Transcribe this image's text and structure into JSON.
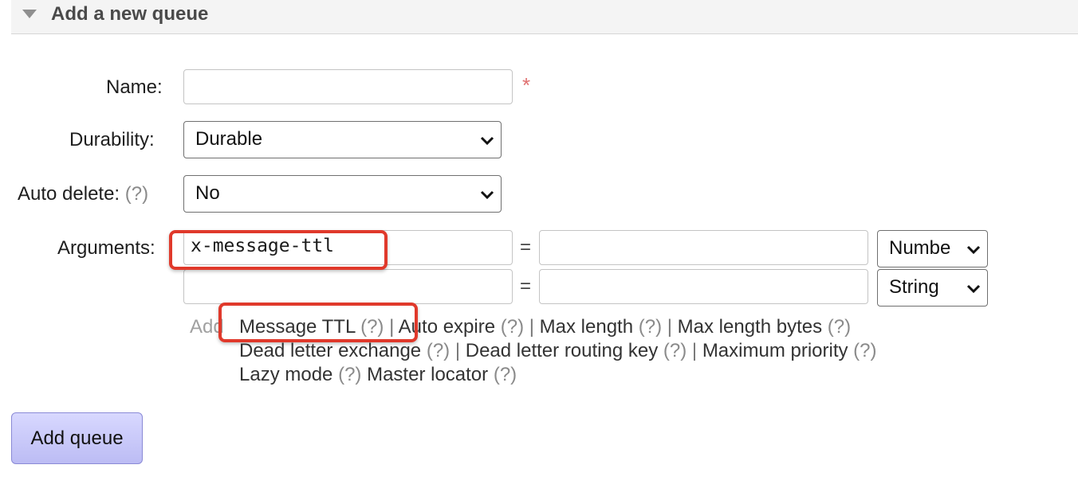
{
  "section": {
    "title": "Add a new queue"
  },
  "form": {
    "name_label": "Name:",
    "name_value": "",
    "required_mark": "*",
    "durability_label": "Durability:",
    "durability_value": "Durable",
    "auto_delete_label": "Auto delete:",
    "auto_delete_help": "(?)",
    "auto_delete_value": "No",
    "arguments_label": "Arguments:",
    "arguments": [
      {
        "key": "x-message-ttl",
        "equals": "=",
        "value": "",
        "type": "Numbe"
      },
      {
        "key": "",
        "equals": "=",
        "value": "",
        "type": "String"
      }
    ],
    "add_label": "Add",
    "quick_links": [
      {
        "label": "Message TTL",
        "help": "(?)"
      },
      {
        "label": "Auto expire",
        "help": "(?)"
      },
      {
        "label": "Max length",
        "help": "(?)"
      },
      {
        "label": "Max length bytes",
        "help": "(?)"
      },
      {
        "label": "Dead letter exchange",
        "help": "(?)"
      },
      {
        "label": "Dead letter routing key",
        "help": "(?)"
      },
      {
        "label": "Maximum priority",
        "help": "(?)"
      },
      {
        "label": "Lazy mode",
        "help": "(?)"
      },
      {
        "label": "Master locator",
        "help": "(?)"
      }
    ],
    "separator": "|",
    "submit_label": "Add queue"
  },
  "colors": {
    "highlight": "#e0392b",
    "button_bg": "#c8c8fa",
    "required": "#e07070"
  },
  "icons": {
    "section_toggle": "triangle-down-icon",
    "select_arrow": "chevron-down-icon"
  }
}
